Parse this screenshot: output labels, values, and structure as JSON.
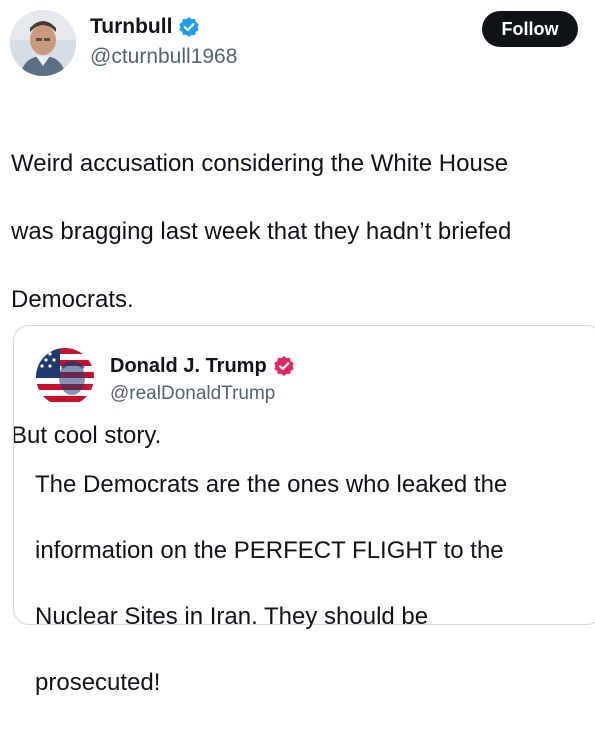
{
  "tweet": {
    "display_name": "Turnbull",
    "handle": "@cturnbull1968",
    "follow_label": "Follow",
    "text_lines": [
      "Weird accusation considering the White House",
      "was bragging last week that they hadn’t briefed",
      "Democrats.",
      "",
      "But cool story."
    ],
    "verified_badge_color": "#1d9bf0"
  },
  "quoted_tweet": {
    "display_name": "Donald J. Trump",
    "handle": "@realDonaldTrump",
    "text_lines": [
      "The Democrats are the ones who leaked the",
      "information on the PERFECT FLIGHT to the",
      "Nuclear Sites in Iran. They should be",
      "prosecuted!"
    ],
    "verified_badge_color": "#e0245e"
  },
  "icons": {
    "author_avatar": "avatar-photo-icon",
    "quoted_avatar": "flag-portrait-avatar-icon",
    "verified": "verified-badge-icon"
  }
}
